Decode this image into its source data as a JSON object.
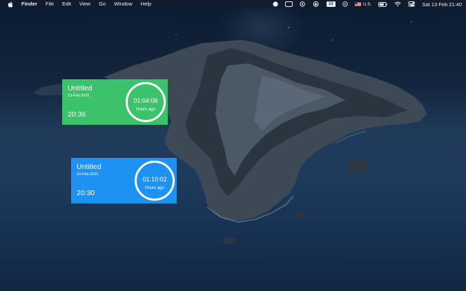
{
  "menubar": {
    "apple_icon": "apple-icon",
    "items": [
      "Finder",
      "File",
      "Edit",
      "View",
      "Go",
      "Window",
      "Help"
    ],
    "status": {
      "icons": [
        "record-dot-icon",
        "window-icon",
        "gear-icon",
        "cloud-icon"
      ],
      "calendar_day": "13",
      "input_source": "U.S.",
      "input_flag_icon": "us-flag-icon",
      "battery_icon": "battery-icon",
      "wifi_icon": "wifi-icon",
      "control_center_icon": "control-center-icon",
      "clock": "Sat 13 Feb  21:40"
    }
  },
  "widgets": [
    {
      "title": "Untitled",
      "date": "13-Feb-2021",
      "time": "20:36",
      "elapsed": "01:04:08",
      "ago_label": "Hours ago",
      "color": "#3cc26b"
    },
    {
      "title": "Untitled",
      "date": "13-Feb-2021",
      "time": "20:30",
      "elapsed": "01:10:02",
      "ago_label": "Hours ago",
      "color": "#1e92f2"
    }
  ]
}
